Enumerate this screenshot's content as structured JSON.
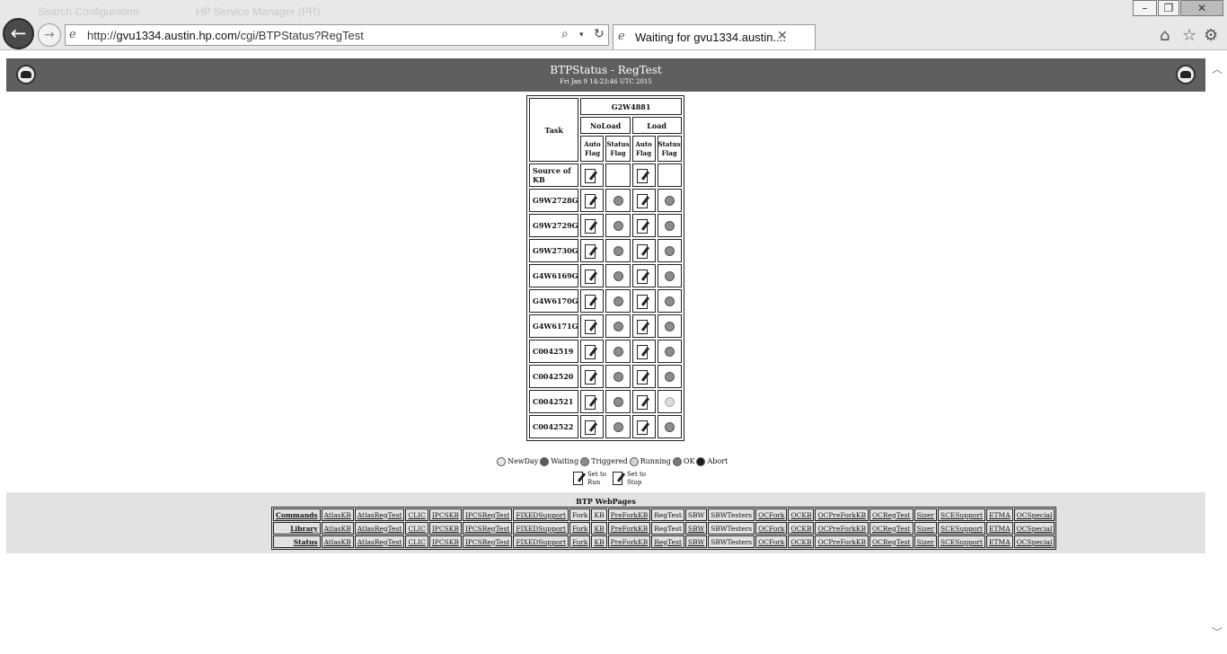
{
  "browser": {
    "ghost_tabs": [
      "Search Configuration",
      "HP Service Manager (PR)"
    ],
    "address_url_prefix": "http://",
    "address_url_host": "gvu1334.austin.hp.com",
    "address_url_path": "/cgi/BTPStatus?RegTest",
    "active_tab_title": "Waiting for gvu1334.austin....",
    "icons": {
      "back": "back-arrow-icon",
      "forward": "forward-arrow-icon",
      "search": "search-icon",
      "refresh": "refresh-icon",
      "home": "home-icon",
      "favorites": "star-icon",
      "settings": "gear-icon"
    }
  },
  "header": {
    "title": "BTPStatus - RegTest",
    "date": "Fri Jan 9 14:23:46 UTC 2015"
  },
  "status_table": {
    "task_header": "Task",
    "group_header": "G2W4881",
    "subgroups": [
      "NoLoad",
      "Load"
    ],
    "flag_headers": [
      "Auto Flag",
      "Status Flag"
    ],
    "rows": [
      {
        "task": "Source of KB",
        "statuses": [
          null,
          null
        ]
      },
      {
        "task": "G9W2728G",
        "statuses": [
          "waiting",
          "waiting"
        ]
      },
      {
        "task": "G9W2729G",
        "statuses": [
          "waiting",
          "waiting"
        ]
      },
      {
        "task": "G9W2730G",
        "statuses": [
          "waiting",
          "waiting"
        ]
      },
      {
        "task": "G4W6169G",
        "statuses": [
          "waiting",
          "waiting"
        ]
      },
      {
        "task": "G4W6170G",
        "statuses": [
          "waiting",
          "waiting"
        ]
      },
      {
        "task": "G4W6171G",
        "statuses": [
          "waiting",
          "waiting"
        ]
      },
      {
        "task": "C0042519",
        "statuses": [
          "waiting",
          "waiting"
        ]
      },
      {
        "task": "C0042520",
        "statuses": [
          "waiting",
          "waiting"
        ]
      },
      {
        "task": "C0042521",
        "statuses": [
          "waiting",
          "running"
        ]
      },
      {
        "task": "C0042522",
        "statuses": [
          "waiting",
          "waiting"
        ]
      }
    ]
  },
  "legend": {
    "states": [
      {
        "label": "NewDay",
        "color": "#e6e6e6"
      },
      {
        "label": "Waiting",
        "color": "#5c5c5c"
      },
      {
        "label": "Triggered",
        "color": "#8d8d8d"
      },
      {
        "label": "Running",
        "color": "#d4d4d4"
      },
      {
        "label": "OK",
        "color": "#7a7a7a"
      },
      {
        "label": "Abort",
        "color": "#1e1e1e"
      }
    ],
    "actions": [
      {
        "line1": "Set to",
        "line2": "Run"
      },
      {
        "line1": "Set to",
        "line2": "Stop"
      }
    ]
  },
  "webpages": {
    "title": "BTP WebPages",
    "rows": [
      {
        "label": "Commands",
        "links": [
          "AtlasKB",
          "AtlasRegTest",
          "CLIC",
          "IPCSKB",
          "IPCSRegTest",
          "FIXEDSupport",
          "Fork",
          "KB",
          "PreForkKB",
          "RegTest",
          "SBW",
          "SBWTesters",
          "OCFork",
          "OCKB",
          "OCPreForkKB",
          "OCRegTest",
          "Sizer",
          "SCESupport",
          "ETMA",
          "OCSpecial"
        ]
      },
      {
        "label": "Library",
        "links": [
          "AtlasKB",
          "AtlasRegTest",
          "CLIC",
          "IPCSKB",
          "IPCSRegTest",
          "FIXEDSupport",
          "Fork",
          "KB",
          "PreForkKB",
          "RegTest",
          "SBW",
          "SBWTesters",
          "OCFork",
          "OCKB",
          "OCPreForkKB",
          "OCRegTest",
          "Sizer",
          "SCESupport",
          "ETMA",
          "OCSpecial"
        ]
      },
      {
        "label": "Status",
        "links": [
          "AtlasKB",
          "AtlasRegTest",
          "CLIC",
          "IPCSKB",
          "IPCSRegTest",
          "FIXEDSupport",
          "Fork",
          "KB",
          "PreForkKB",
          "RegTest",
          "SBW",
          "SBWTesters",
          "OCFork",
          "OCKB",
          "OCPreForkKB",
          "OCRegTest",
          "Sizer",
          "SCESupport",
          "ETMA",
          "OCSpecial"
        ]
      }
    ]
  }
}
